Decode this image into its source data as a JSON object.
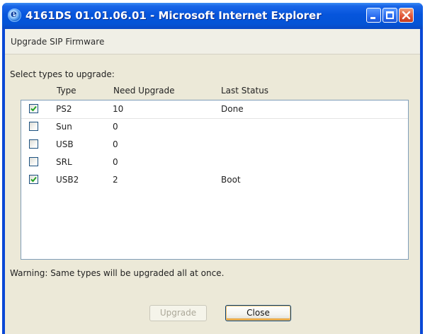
{
  "window": {
    "title": "4161DS 01.01.06.01 - Microsoft Internet Explorer"
  },
  "page": {
    "title": "Upgrade SIP Firmware",
    "section_label": "Select types to upgrade:",
    "warning": "Warning: Same types will be upgraded all at once."
  },
  "table": {
    "columns": [
      "Type",
      "Need Upgrade",
      "Last Status"
    ],
    "rows": [
      {
        "checked": true,
        "type": "PS2",
        "need_upgrade": "10",
        "last_status": "Done"
      },
      {
        "checked": false,
        "type": "Sun",
        "need_upgrade": "0",
        "last_status": ""
      },
      {
        "checked": false,
        "type": "USB",
        "need_upgrade": "0",
        "last_status": ""
      },
      {
        "checked": false,
        "type": "SRL",
        "need_upgrade": "0",
        "last_status": ""
      },
      {
        "checked": true,
        "type": "USB2",
        "need_upgrade": "2",
        "last_status": "Boot"
      }
    ]
  },
  "buttons": {
    "upgrade": "Upgrade",
    "close": "Close"
  },
  "colors": {
    "titlebar": "#0454d6",
    "client_bg": "#ece9d8",
    "checkmark": "#21a121",
    "close_button_hover": "#e5a43e"
  }
}
